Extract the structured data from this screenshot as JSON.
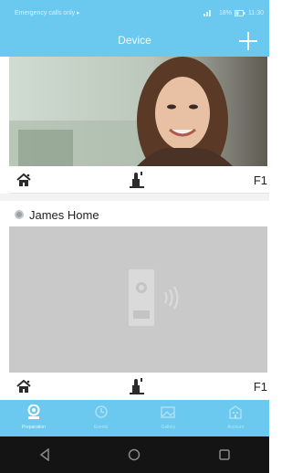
{
  "status_bar": {
    "left_text": "Emergency calls only",
    "right_text": "18%",
    "time": "11:30"
  },
  "header": {
    "title": "Device",
    "add_icon": "plus-icon"
  },
  "devices": [
    {
      "name": "",
      "floor": "F1",
      "icons": [
        "home-icon",
        "unlock-icon"
      ],
      "camera_state": "live"
    },
    {
      "name": "James Home",
      "floor": "F1",
      "icons": [
        "home-icon",
        "unlock-icon"
      ],
      "camera_state": "placeholder",
      "status": "offline"
    }
  ],
  "tabs": [
    {
      "label": "Preparation",
      "icon": "camera-icon",
      "active": true
    },
    {
      "label": "Events",
      "icon": "clock-icon",
      "active": false
    },
    {
      "label": "Gallery",
      "icon": "gallery-icon",
      "active": false
    },
    {
      "label": "Account",
      "icon": "building-icon",
      "active": false
    }
  ],
  "nav": [
    "back-icon",
    "home-icon",
    "recents-icon"
  ],
  "colors": {
    "accent": "#6bc8ee",
    "nav_bar": "#141414"
  }
}
